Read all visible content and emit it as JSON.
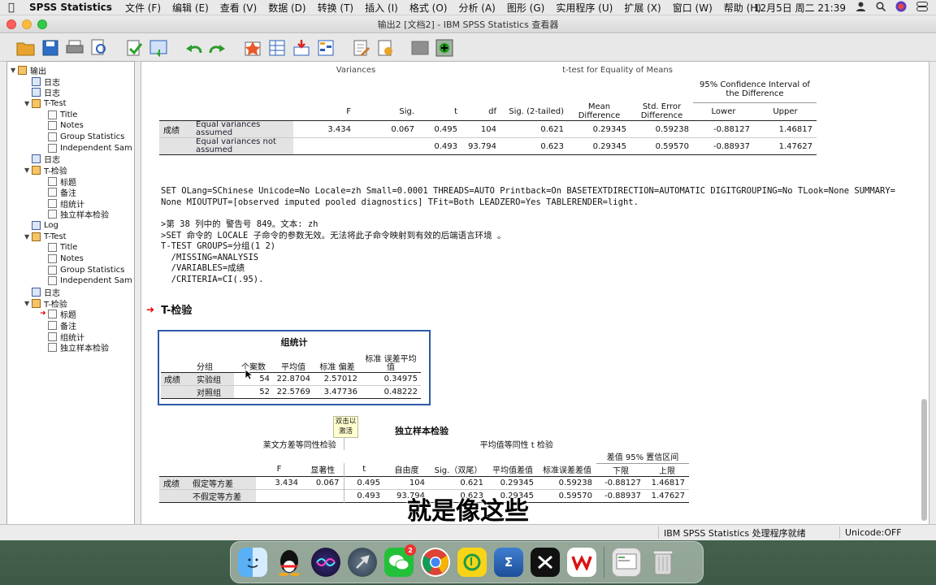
{
  "menubar": {
    "app": "SPSS Statistics",
    "items": [
      "文件 (F)",
      "编辑 (E)",
      "查看 (V)",
      "数据 (D)",
      "转换 (T)",
      "插入 (I)",
      "格式 (O)",
      "分析 (A)",
      "图形 (G)",
      "实用程序 (U)",
      "扩展 (X)",
      "窗口 (W)",
      "帮助 (H)"
    ],
    "clock": "12月5日 周二  21:39"
  },
  "window": {
    "title": "输出2 [文档2] - IBM SPSS Statistics 查看器"
  },
  "outline": {
    "items": [
      {
        "label": "输出",
        "level": 0,
        "icon": "book-icon"
      },
      {
        "label": "日志",
        "level": 1,
        "icon": "log-icon"
      },
      {
        "label": "日志",
        "level": 1,
        "icon": "log-icon"
      },
      {
        "label": "T-Test",
        "level": 1,
        "icon": "book-icon"
      },
      {
        "label": "Title",
        "level": 2,
        "icon": "doc-icon"
      },
      {
        "label": "Notes",
        "level": 2,
        "icon": "doc-icon"
      },
      {
        "label": "Group Statistics",
        "level": 2,
        "icon": "doc-icon"
      },
      {
        "label": "Independent Sam",
        "level": 2,
        "icon": "doc-icon"
      },
      {
        "label": "日志",
        "level": 1,
        "icon": "log-icon"
      },
      {
        "label": "T-检验",
        "level": 1,
        "icon": "book-icon"
      },
      {
        "label": "标题",
        "level": 2,
        "icon": "doc-icon"
      },
      {
        "label": "备注",
        "level": 2,
        "icon": "doc-icon"
      },
      {
        "label": "组统计",
        "level": 2,
        "icon": "doc-icon"
      },
      {
        "label": "独立样本检验",
        "level": 2,
        "icon": "doc-icon"
      },
      {
        "label": "Log",
        "level": 1,
        "icon": "log-icon"
      },
      {
        "label": "T-Test",
        "level": 1,
        "icon": "book-icon"
      },
      {
        "label": "Title",
        "level": 2,
        "icon": "doc-icon"
      },
      {
        "label": "Notes",
        "level": 2,
        "icon": "doc-icon"
      },
      {
        "label": "Group Statistics",
        "level": 2,
        "icon": "doc-icon"
      },
      {
        "label": "Independent Sam",
        "level": 2,
        "icon": "doc-icon"
      },
      {
        "label": "日志",
        "level": 1,
        "icon": "log-icon"
      },
      {
        "label": "T-检验",
        "level": 1,
        "icon": "book-icon"
      },
      {
        "label": "标题",
        "level": 2,
        "icon": "doc-icon",
        "selected": true
      },
      {
        "label": "备注",
        "level": 2,
        "icon": "doc-icon"
      },
      {
        "label": "组统计",
        "level": 2,
        "icon": "doc-icon"
      },
      {
        "label": "独立样本检验",
        "level": 2,
        "icon": "doc-icon"
      }
    ]
  },
  "table1": {
    "hdr_variances": "Variances",
    "hdr_ttest": "t-test for Equality of Means",
    "hdr_ci": "95% Confidence Interval of the Difference",
    "cols": [
      "F",
      "Sig.",
      "t",
      "df",
      "Sig. (2-tailed)",
      "Mean Difference",
      "Std. Error Difference",
      "Lower",
      "Upper"
    ],
    "var": "成绩",
    "rows": [
      {
        "label": "Equal variances assumed",
        "vals": [
          "3.434",
          "0.067",
          "0.495",
          "104",
          "0.621",
          "0.29345",
          "0.59238",
          "-0.88127",
          "1.46817"
        ]
      },
      {
        "label": "Equal variances not assumed",
        "vals": [
          "",
          "",
          "0.493",
          "93.794",
          "0.623",
          "0.29345",
          "0.59570",
          "-0.88937",
          "1.47627"
        ]
      }
    ]
  },
  "syntax": {
    "line1": "SET OLang=SChinese Unicode=No Locale=zh Small=0.0001 THREADS=AUTO Printback=On BASETEXTDIRECTION=AUTOMATIC DIGITGROUPING=No TLook=None SUMMARY=",
    "line2": "None MIOUTPUT=[observed imputed pooled diagnostics] TFit=Both LEADZERO=Yes TABLERENDER=light.",
    "warn1": ">第 38 列中的 警告号 849。文本: zh",
    "warn2": ">SET 命令的 LOCALE 子命令的参数无效。无法将此子命令映射到有效的后端语言环境 。",
    "cmd1": "T-TEST GROUPS=分组(1 2)",
    "cmd2": "  /MISSING=ANALYSIS",
    "cmd3": "  /VARIABLES=成绩",
    "cmd4": "  /CRITERIA=CI(.95)."
  },
  "heading": "T-检验",
  "group_stats": {
    "title": "组统计",
    "cols": [
      "分组",
      "个案数",
      "平均值",
      "标准 偏差",
      "标准 误差平均值"
    ],
    "var": "成绩",
    "rows": [
      {
        "group": "实验组",
        "n": "54",
        "mean": "22.8704",
        "sd": "2.57012",
        "se": "0.34975"
      },
      {
        "group": "对照组",
        "n": "52",
        "mean": "22.5769",
        "sd": "3.47736",
        "se": "0.48222"
      }
    ]
  },
  "tooltip": "双击以激活",
  "indep_test": {
    "title": "独立样本检验",
    "hdr_levene": "莱文方差等同性检验",
    "hdr_ttest": "平均值等同性 t 检验",
    "hdr_ci": "差值 95% 置信区间",
    "cols": [
      "F",
      "显著性",
      "t",
      "自由度",
      "Sig.（双尾）",
      "平均值差值",
      "标准误差差值",
      "下限",
      "上限"
    ],
    "var": "成绩",
    "rows": [
      {
        "label": "假定等方差",
        "vals": [
          "3.434",
          "0.067",
          "0.495",
          "104",
          "0.621",
          "0.29345",
          "0.59238",
          "-0.88127",
          "1.46817"
        ]
      },
      {
        "label": "不假定等方差",
        "vals": [
          "",
          "",
          "0.493",
          "93.794",
          "0.623",
          "0.29345",
          "0.59570",
          "-0.88937",
          "1.47627"
        ]
      }
    ]
  },
  "subtitle": "就是像这些",
  "status": {
    "processor": "IBM SPSS Statistics 处理程序就绪",
    "unicode": "Unicode:OFF"
  },
  "dock": {
    "badge": "2"
  }
}
